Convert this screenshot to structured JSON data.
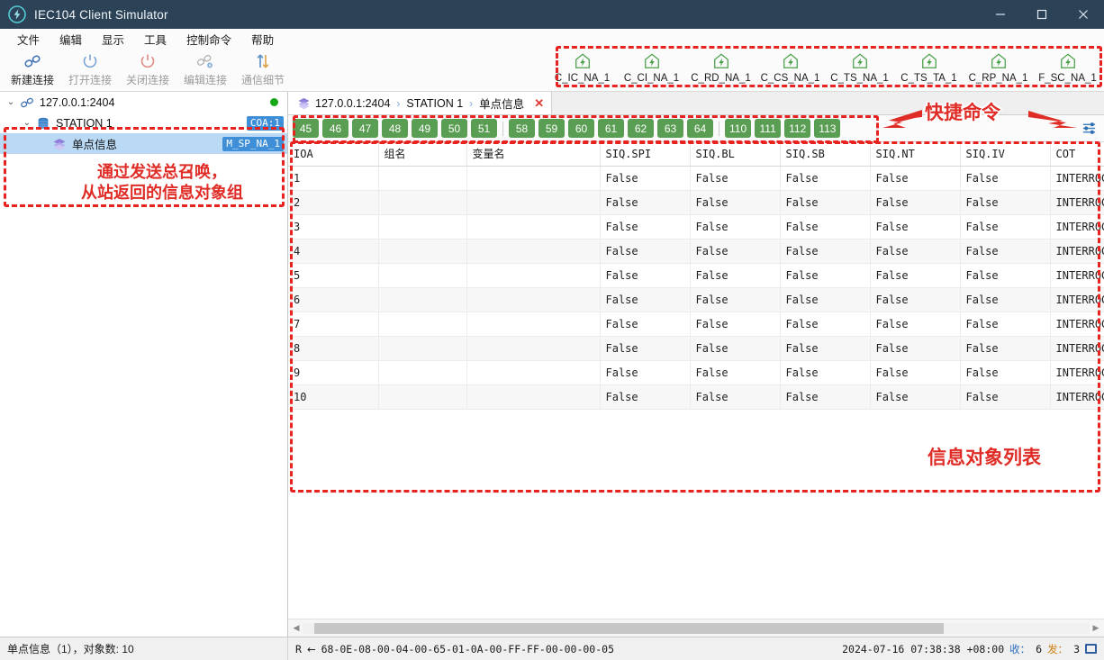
{
  "window": {
    "title": "IEC104 Client Simulator",
    "logo_icon": "lightning-circle-icon",
    "minimize": "—",
    "maximize": "□",
    "close": "✕"
  },
  "menubar": {
    "items": [
      {
        "label": "文件"
      },
      {
        "label": "编辑"
      },
      {
        "label": "显示"
      },
      {
        "label": "工具"
      },
      {
        "label": "控制命令"
      },
      {
        "label": "帮助"
      }
    ]
  },
  "toolbar": {
    "buttons": [
      {
        "label": "新建连接",
        "icon": "link-icon",
        "enabled": true
      },
      {
        "label": "打开连接",
        "icon": "power-on-icon",
        "enabled": false
      },
      {
        "label": "关闭连接",
        "icon": "power-off-icon",
        "enabled": false
      },
      {
        "label": "编辑连接",
        "icon": "link-gear-icon",
        "enabled": false
      },
      {
        "label": "通信细节",
        "icon": "transfer-arrows-icon",
        "enabled": false
      }
    ],
    "commands": [
      {
        "label": "C_IC_NA_1",
        "icon": "house-lightning-icon"
      },
      {
        "label": "C_CI_NA_1",
        "icon": "house-lightning-icon"
      },
      {
        "label": "C_RD_NA_1",
        "icon": "house-lightning-icon"
      },
      {
        "label": "C_CS_NA_1",
        "icon": "house-lightning-icon"
      },
      {
        "label": "C_TS_NA_1",
        "icon": "house-lightning-icon"
      },
      {
        "label": "C_TS_TA_1",
        "icon": "house-lightning-icon"
      },
      {
        "label": "C_RP_NA_1",
        "icon": "house-lightning-icon"
      },
      {
        "label": "F_SC_NA_1",
        "icon": "house-lightning-icon"
      }
    ]
  },
  "tree": {
    "nodes": [
      {
        "label": "127.0.0.1:2404",
        "icon": "link-icon",
        "expander": "⌄",
        "indent": 0,
        "status_dot": true,
        "badge": "",
        "selected": false
      },
      {
        "label": "STATION 1",
        "icon": "database-icon",
        "expander": "⌄",
        "indent": 1,
        "status_dot": false,
        "badge": "COA:1",
        "selected": false
      },
      {
        "label": "单点信息",
        "icon": "layers-icon",
        "expander": "",
        "indent": 2,
        "status_dot": false,
        "badge": "M_SP_NA_1",
        "selected": true
      }
    ]
  },
  "annotations": {
    "tree": "通过发送总召唤，\n从站返回的信息对象组",
    "quick_commands": "快捷命令",
    "object_list": "信息对象列表"
  },
  "tab": {
    "icon": "layers-icon",
    "crumbs": [
      "127.0.0.1:2404",
      "STATION 1",
      "单点信息"
    ],
    "separator": "›",
    "close": "✕"
  },
  "badges": {
    "group_a": [
      "45",
      "46",
      "47",
      "48",
      "49",
      "50",
      "51"
    ],
    "group_b": [
      "58",
      "59",
      "60",
      "61",
      "62",
      "63",
      "64"
    ],
    "group_c": [
      "110",
      "111",
      "112",
      "113"
    ],
    "filter_icon": "settings-sliders-icon"
  },
  "table": {
    "columns": [
      "IOA",
      "组名",
      "变量名",
      "SIQ.SPI",
      "SIQ.BL",
      "SIQ.SB",
      "SIQ.NT",
      "SIQ.IV",
      "COT"
    ],
    "rows": [
      [
        "1",
        "",
        "",
        "False",
        "False",
        "False",
        "False",
        "False",
        "INTERROGATED_B"
      ],
      [
        "2",
        "",
        "",
        "False",
        "False",
        "False",
        "False",
        "False",
        "INTERROGATED_B"
      ],
      [
        "3",
        "",
        "",
        "False",
        "False",
        "False",
        "False",
        "False",
        "INTERROGATED_B"
      ],
      [
        "4",
        "",
        "",
        "False",
        "False",
        "False",
        "False",
        "False",
        "INTERROGATED_B"
      ],
      [
        "5",
        "",
        "",
        "False",
        "False",
        "False",
        "False",
        "False",
        "INTERROGATED_B"
      ],
      [
        "6",
        "",
        "",
        "False",
        "False",
        "False",
        "False",
        "False",
        "INTERROGATED_B"
      ],
      [
        "7",
        "",
        "",
        "False",
        "False",
        "False",
        "False",
        "False",
        "INTERROGATED_B"
      ],
      [
        "8",
        "",
        "",
        "False",
        "False",
        "False",
        "False",
        "False",
        "INTERROGATED_B"
      ],
      [
        "9",
        "",
        "",
        "False",
        "False",
        "False",
        "False",
        "False",
        "INTERROGATED_B"
      ],
      [
        "10",
        "",
        "",
        "False",
        "False",
        "False",
        "False",
        "False",
        "INTERROGATED_B"
      ]
    ]
  },
  "statusbar": {
    "left": "单点信息（1），对象数: 10",
    "direction": "R",
    "arrow": "←",
    "frame": "68-0E-08-00-04-00-65-01-0A-00-FF-FF-00-00-00-05",
    "timestamp": "2024-07-16 07:38:38 +08:00",
    "recv_label": "收：",
    "recv_count": "6",
    "send_label": "发：",
    "send_count": "3",
    "status_icon": "window-icon"
  },
  "colors": {
    "titlebar": "#2b4257",
    "badge_green": "#5a9e53",
    "badge_blue": "#3e8fd8",
    "annotation_red": "#e8231f",
    "selection_blue": "#b9d9f5",
    "status_dot_green": "#17a81a"
  }
}
